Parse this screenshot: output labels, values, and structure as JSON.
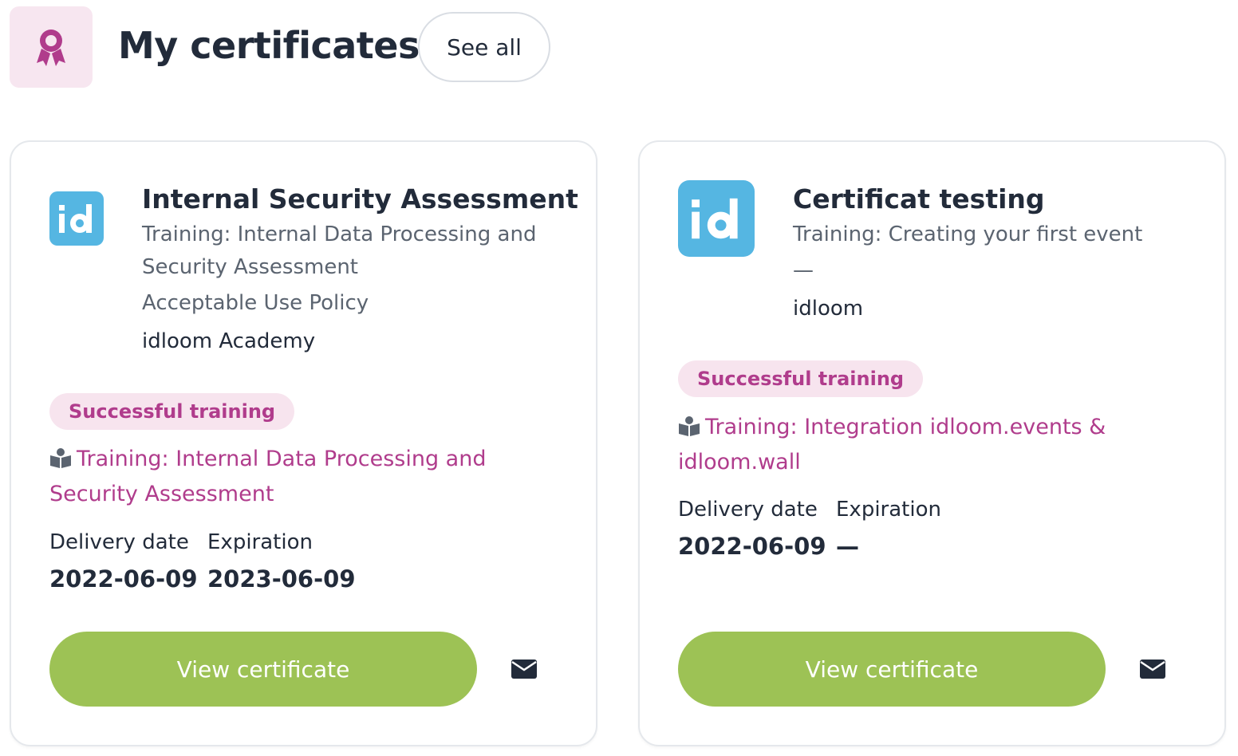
{
  "header": {
    "icon": "award-ribbon-icon",
    "title": "My certificates",
    "see_all_label": "See all"
  },
  "cards": [
    {
      "logo": "idloom-logo",
      "title": "Internal Security Assessment",
      "subtitle": "Training: Internal Data Processing and Security Assessment",
      "line": "Acceptable Use Policy",
      "org": "idloom Academy",
      "badge": "Successful training",
      "training_icon": "book-reader-icon",
      "training_link": "Training: Internal Data Processing and Security Assessment",
      "delivery_label": "Delivery date",
      "delivery_value": "2022-06-09",
      "expiration_label": "Expiration",
      "expiration_value": "2023-06-09",
      "view_label": "View certificate",
      "mail_icon": "envelope-icon"
    },
    {
      "logo": "idloom-logo",
      "title": "Certificat testing",
      "subtitle": "Training: Creating your first event",
      "line": "—",
      "org": "idloom",
      "badge": "Successful training",
      "training_icon": "book-reader-icon",
      "training_link": "Training: Integration idloom.events & idloom.wall",
      "delivery_label": "Delivery date",
      "delivery_value": "2022-06-09",
      "expiration_label": "Expiration",
      "expiration_value": "—",
      "view_label": "View certificate",
      "mail_icon": "envelope-icon"
    }
  ],
  "colors": {
    "accent": "#b03c8c",
    "badge_bg": "#f7e4ee",
    "header_icon_bg": "#f7e6f0",
    "logo_bg": "#55b6e2",
    "button_green": "#9dc255",
    "text_dark": "#222b3a",
    "text_muted": "#5b6470"
  }
}
